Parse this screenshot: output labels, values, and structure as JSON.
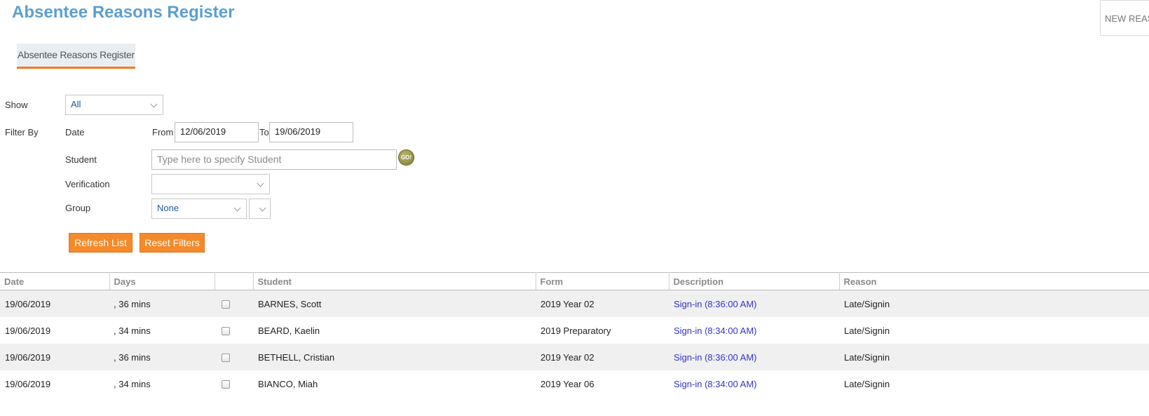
{
  "header": {
    "title": "Absentee Reasons Register",
    "new_button_label": "NEW REAS"
  },
  "tabs": [
    {
      "label": "Absentee Reasons Register",
      "active": true
    }
  ],
  "filters": {
    "show_label": "Show",
    "show_value": "All",
    "filter_by_label": "Filter By",
    "date_label": "Date",
    "from_label": "From",
    "from_value": "12/06/2019",
    "to_label": "To",
    "to_value": "19/06/2019",
    "student_label": "Student",
    "student_placeholder": "Type here to specify Student",
    "go_label": "GO!",
    "verification_label": "Verification",
    "verification_value": "",
    "group_label": "Group",
    "group_value": "None",
    "group_sub_value": ""
  },
  "actions": {
    "refresh_label": "Refresh List",
    "reset_label": "Reset Filters"
  },
  "table": {
    "columns": [
      "Date",
      "Days",
      "",
      "Student",
      "Form",
      "Description",
      "Reason"
    ],
    "rows": [
      {
        "date": "19/06/2019",
        "days": ", 36 mins",
        "student": "BARNES, Scott",
        "form": "2019 Year 02",
        "description": "Sign-in (8:36:00 AM)",
        "reason": "Late/Signin"
      },
      {
        "date": "19/06/2019",
        "days": ", 34 mins",
        "student": "BEARD, Kaelin",
        "form": "2019 Preparatory",
        "description": "Sign-in (8:34:00 AM)",
        "reason": "Late/Signin"
      },
      {
        "date": "19/06/2019",
        "days": ", 36 mins",
        "student": "BETHELL, Cristian",
        "form": "2019 Year 02",
        "description": "Sign-in (8:36:00 AM)",
        "reason": "Late/Signin"
      },
      {
        "date": "19/06/2019",
        "days": ", 34 mins",
        "student": "BIANCO, Miah",
        "form": "2019 Year 06",
        "description": "Sign-in (8:34:00 AM)",
        "reason": "Late/Signin"
      }
    ]
  },
  "colors": {
    "title": "#5b9fd1",
    "accent": "#f58a2b",
    "link": "#3333cc"
  }
}
